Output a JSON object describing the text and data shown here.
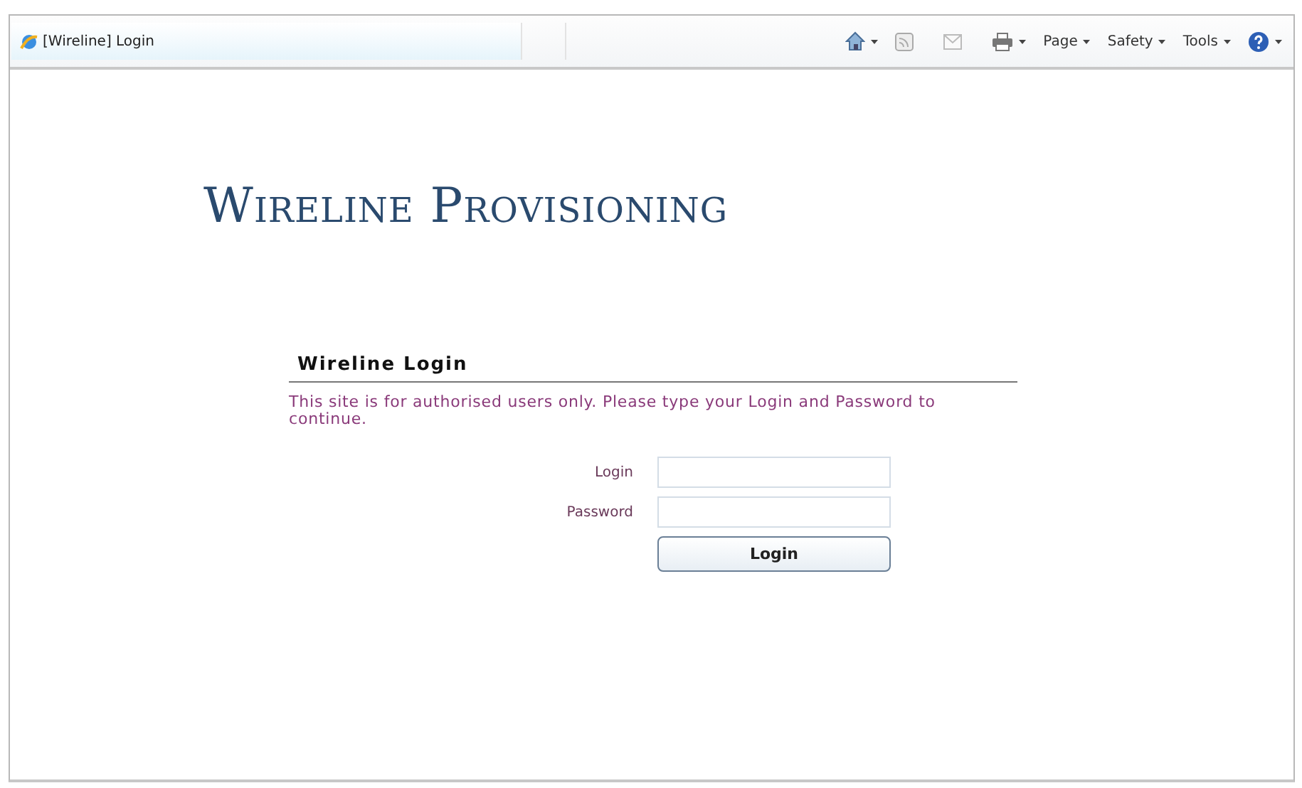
{
  "browser": {
    "tab": {
      "title": "[Wireline] Login"
    },
    "toolbar": [
      {
        "kind": "home",
        "dropdown": true
      },
      {
        "kind": "feeds",
        "dropdown": false
      },
      {
        "kind": "mail",
        "dropdown": false
      },
      {
        "kind": "print",
        "dropdown": true
      },
      {
        "kind": "menu",
        "label": "Page",
        "dropdown": true
      },
      {
        "kind": "menu",
        "label": "Safety",
        "dropdown": true
      },
      {
        "kind": "menu",
        "label": "Tools",
        "dropdown": true
      },
      {
        "kind": "help",
        "dropdown": true
      }
    ]
  },
  "page": {
    "title": "Wireline Provisioning",
    "login": {
      "heading": "Wireline Login",
      "notice": "This site is for authorised users only. Please type your Login and Password to continue.",
      "fields": [
        {
          "label": "Login"
        },
        {
          "label": "Password"
        }
      ],
      "button": "Login"
    }
  }
}
